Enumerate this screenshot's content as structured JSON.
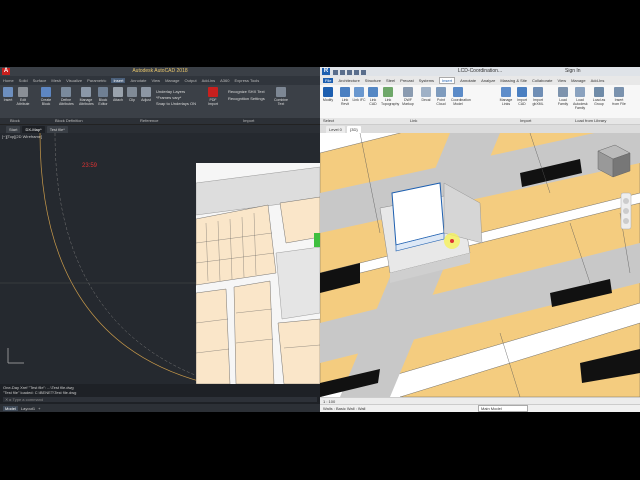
{
  "acad": {
    "title": "Autodesk AutoCAD 2018",
    "menu_tabs": [
      "Home",
      "Solid",
      "Surface",
      "Mesh",
      "Visualize",
      "Parametric",
      "Insert",
      "Annotate",
      "View",
      "Manage",
      "Output",
      "Add-ins",
      "A360",
      "Express Tools",
      "Featured Apps"
    ],
    "active_tab": "Insert",
    "tools": [
      "Insert",
      "Edit Attribute",
      "Create Block",
      "Define Attributes",
      "Manage Attributes",
      "Block Editor",
      "Attach",
      "Clip",
      "Adjust",
      "Underlay Layers",
      "*Frames vary*",
      "Snap to Underlays ON",
      "PDF Import",
      "Recognize SHX Text",
      "Recognition Settings",
      "Combine Text"
    ],
    "panels": [
      "Block",
      "Block Definition",
      "Reference",
      "Import"
    ],
    "doc_tabs": [
      "Start",
      "DX-Map*",
      "Test file*"
    ],
    "viewport_label": "[−][Top][2D Wireframe]",
    "time_label": "23:59",
    "cmd_lines": [
      "One-Day Xref \"Test file\": ...\\Test file.dwg",
      "\"Test file\" loaded: C:\\BENET\\Test file.dwg"
    ],
    "cmd_placeholder": "Type a command",
    "status_tabs": [
      "Model",
      "Layout1",
      "+"
    ]
  },
  "revit": {
    "title": "LCD-Coordination...",
    "sign_in": "Sign In",
    "menu_tabs": [
      "File",
      "Architecture",
      "Structure",
      "Steel",
      "Precast",
      "Systems",
      "Insert",
      "Annotate",
      "Analyze",
      "Massing & Site",
      "Collaborate",
      "View",
      "Manage",
      "Add-Ins"
    ],
    "active_tab": "Insert",
    "tools": [
      "Modify",
      "Link Revit",
      "Link IFC",
      "Link CAD",
      "Link Topography",
      "DWF Markup",
      "Decal",
      "Point Cloud",
      "Coordination Model",
      "Manage Links",
      "Import CAD",
      "Import gbXML",
      "Load Family",
      "Load Autodesk Family",
      "Load as Group",
      "Insert from File"
    ],
    "panels": [
      "Select",
      "Link",
      "Import",
      "Load from Library"
    ],
    "doc_tabs": [
      "Level 0",
      "{3D}"
    ],
    "active_doc": "{3D}",
    "scale": "1 : 100",
    "status_text": "Walls : Basic Wall : Wall",
    "main_model": "Main Model"
  },
  "colors": {
    "acad_bg": "#25292f",
    "parcel": "#fae6c9",
    "revit_plot": "#f4cc7f",
    "road": "#c8c8c8",
    "accent_blue": "#1d5fb0"
  }
}
